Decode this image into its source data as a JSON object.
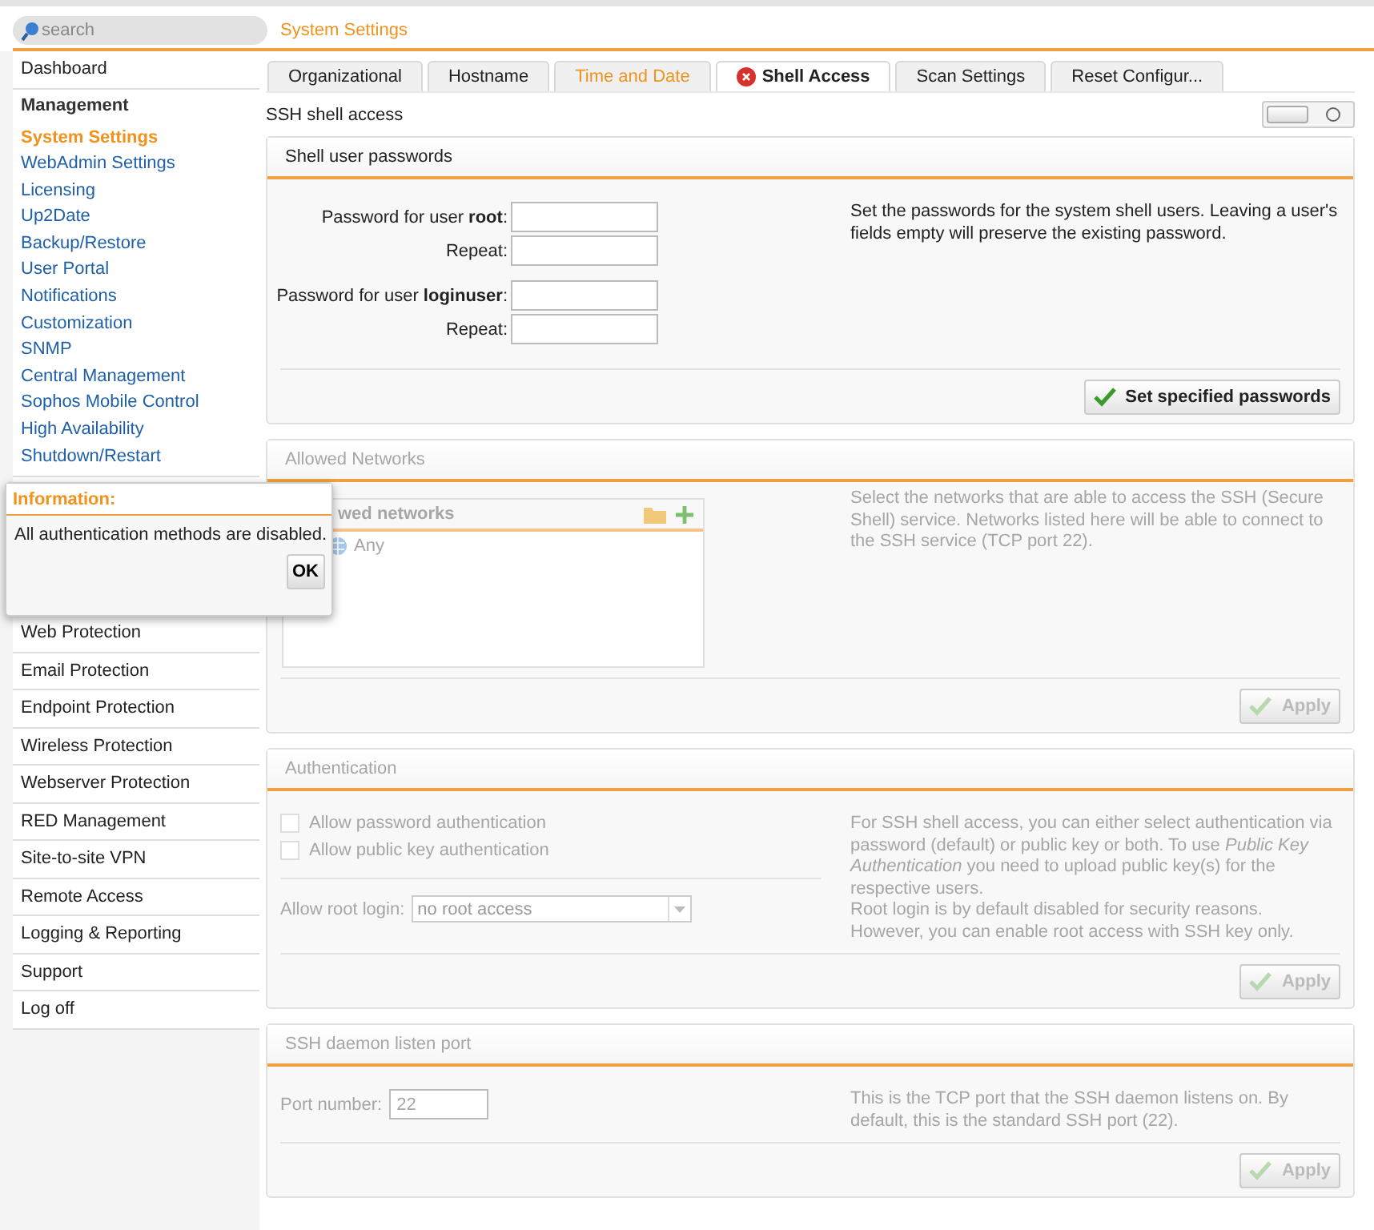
{
  "search": {
    "placeholder": "search"
  },
  "header": {
    "title": "System Settings"
  },
  "sidebar": {
    "items": [
      {
        "label": "Dashboard",
        "kind": "top"
      },
      {
        "label": "Management",
        "kind": "group",
        "children": [
          {
            "label": "System Settings",
            "selected": true
          },
          {
            "label": "WebAdmin Settings",
            "selected": false
          },
          {
            "label": "Licensing",
            "selected": false
          },
          {
            "label": "Up2Date",
            "selected": false
          },
          {
            "label": "Backup/Restore",
            "selected": false
          },
          {
            "label": "User Portal",
            "selected": false
          },
          {
            "label": "Notifications",
            "selected": false
          },
          {
            "label": "Customization",
            "selected": false
          },
          {
            "label": "SNMP",
            "selected": false
          },
          {
            "label": "Central Management",
            "selected": false
          },
          {
            "label": "Sophos Mobile Control",
            "selected": false
          },
          {
            "label": "High Availability",
            "selected": false
          },
          {
            "label": "Shutdown/Restart",
            "selected": false
          }
        ]
      },
      {
        "label": "Web Protection",
        "kind": "top"
      },
      {
        "label": "Email Protection",
        "kind": "top"
      },
      {
        "label": "Endpoint Protection",
        "kind": "top"
      },
      {
        "label": "Wireless Protection",
        "kind": "top"
      },
      {
        "label": "Webserver Protection",
        "kind": "top"
      },
      {
        "label": "RED Management",
        "kind": "top"
      },
      {
        "label": "Site-to-site VPN",
        "kind": "top"
      },
      {
        "label": "Remote Access",
        "kind": "top"
      },
      {
        "label": "Logging & Reporting",
        "kind": "top"
      },
      {
        "label": "Support",
        "kind": "top"
      },
      {
        "label": "Log off",
        "kind": "top"
      }
    ]
  },
  "popup": {
    "title": "Information:",
    "message": "All authentication methods are disabled.",
    "button": "OK"
  },
  "tabs": [
    {
      "label": "Organizational",
      "selected": false,
      "highlighted": false,
      "error": false
    },
    {
      "label": "Hostname",
      "selected": false,
      "highlighted": false,
      "error": false
    },
    {
      "label": "Time and Date",
      "selected": false,
      "highlighted": true,
      "error": false
    },
    {
      "label": "Shell Access",
      "selected": true,
      "highlighted": false,
      "error": true
    },
    {
      "label": "Scan Settings",
      "selected": false,
      "highlighted": false,
      "error": false
    },
    {
      "label": "Reset Configur...",
      "selected": false,
      "highlighted": false,
      "error": false
    }
  ],
  "ssh_access": {
    "label": "SSH shell access",
    "on": false
  },
  "sections": [
    {
      "kind": "passwords",
      "title": "Shell user passwords",
      "disabled": false,
      "users": [
        {
          "fields": [
            {
              "label": "Password for user **root**:"
            },
            {
              "label": "Repeat:"
            }
          ]
        },
        {
          "fields": [
            {
              "label": "Password for user **loginuser**:"
            },
            {
              "label": "Repeat:"
            }
          ]
        }
      ],
      "description": [
        "Set the passwords for the system shell users. Leaving a user's fields empty will preserve the existing password."
      ],
      "button": "Set specified passwords"
    },
    {
      "kind": "networks",
      "title": "Allowed Networks",
      "disabled": true,
      "list": {
        "title": "wed networks",
        "items": [
          {
            "label": "Any"
          }
        ]
      },
      "description": [
        "Select the networks that are able to access the SSH (Secure Shell) service. Networks listed here will be able to connect to the SSH service (TCP port 22)."
      ],
      "button": "Apply"
    },
    {
      "kind": "authentication",
      "title": "Authentication",
      "disabled": true,
      "checkboxes": [
        {
          "label": "Allow password authentication",
          "checked": false
        },
        {
          "label": "Allow public key authentication",
          "checked": false
        }
      ],
      "root_login": {
        "label": "Allow root login:",
        "value": "no root access"
      },
      "description": [
        "For SSH shell access, you can either select authentication via password (default) or public key or both. To use *Public Key Authentication* you need to upload public key(s) for the respective users.",
        "Root login is by default disabled for security reasons. However, you can enable root access with SSH key only."
      ],
      "button": "Apply"
    },
    {
      "kind": "port",
      "title": "SSH daemon listen port",
      "disabled": true,
      "field": {
        "label": "Port number:",
        "value": "22"
      },
      "description": [
        "This is the TCP port that the SSH daemon listens on. By default, this is the standard SSH port (22)."
      ],
      "button": "Apply"
    }
  ]
}
